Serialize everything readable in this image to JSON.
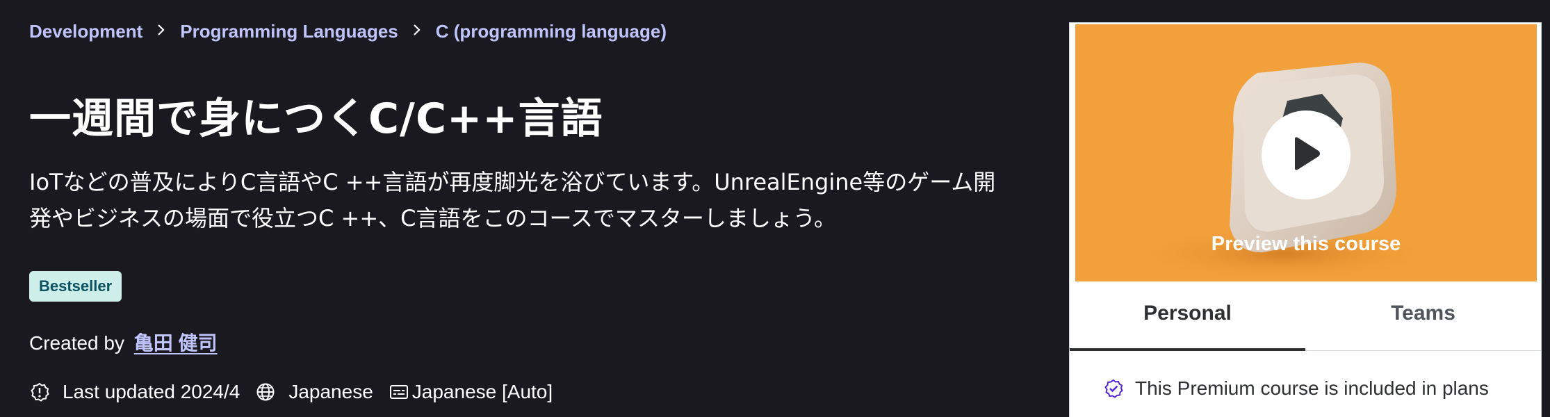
{
  "breadcrumb": [
    {
      "label": "Development"
    },
    {
      "label": "Programming Languages"
    },
    {
      "label": "C (programming language)"
    }
  ],
  "course": {
    "title": "一週間で身につくC/C++言語",
    "subtitle": "IoTなどの普及によりC言語やC ++言語が再度脚光を浴びています。UnrealEngine等のゲーム開発やビジネスの場面で役立つC ++、C言語をこのコースでマスターしましょう。",
    "badge": "Bestseller",
    "created_by_label": "Created by",
    "author": "亀田 健司",
    "last_updated": "Last updated 2024/4",
    "language": "Japanese",
    "captions": "Japanese [Auto]"
  },
  "sidebar_card": {
    "preview_label": "Preview this course",
    "tabs": [
      {
        "label": "Personal",
        "active": true
      },
      {
        "label": "Teams",
        "active": false
      }
    ],
    "included_text": "This Premium course is included in plans"
  },
  "icons": {
    "breadcrumb_separator": "chevron-right-icon",
    "last_updated": "alert-badge-icon",
    "language": "globe-icon",
    "captions": "closed-captions-icon",
    "preview": "play-icon",
    "included": "premium-check-icon"
  },
  "colors": {
    "background": "#1a1920",
    "breadcrumb": "#c0c4fc",
    "badge_bg": "#cdeee9",
    "badge_text": "#0d5261",
    "preview_bg": "#f2a03b",
    "premium_accent": "#5624d0"
  }
}
